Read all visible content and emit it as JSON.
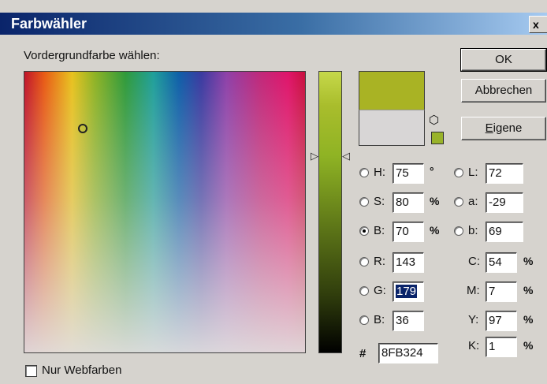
{
  "window": {
    "title": "Farbwähler",
    "close_glyph": "x"
  },
  "prompt": "Vordergrundfarbe wählen:",
  "buttons": {
    "ok": "OK",
    "cancel": "Abbrechen",
    "custom_first": "E",
    "custom_rest": "igene"
  },
  "colors": {
    "new": "#A9B324",
    "old": "#D8D6D6",
    "web_safe": "#99B32A"
  },
  "hsb": [
    {
      "label": "H:",
      "value": "75",
      "unit": "°",
      "checked": false
    },
    {
      "label": "S:",
      "value": "80",
      "unit": "%",
      "checked": false
    },
    {
      "label": "B:",
      "value": "70",
      "unit": "%",
      "checked": true
    }
  ],
  "lab": [
    {
      "label": "L:",
      "value": "72"
    },
    {
      "label": "a:",
      "value": "-29"
    },
    {
      "label": "b:",
      "value": "69"
    }
  ],
  "rgb": [
    {
      "label": "R:",
      "value": "143"
    },
    {
      "label": "G:",
      "value": "179",
      "selected": true
    },
    {
      "label": "B:",
      "value": "36"
    }
  ],
  "cmyk": [
    {
      "label": "C:",
      "value": "54",
      "unit": "%"
    },
    {
      "label": "M:",
      "value": "7",
      "unit": "%"
    },
    {
      "label": "Y:",
      "value": "97",
      "unit": "%"
    },
    {
      "label": "K:",
      "value": "1",
      "unit": "%"
    }
  ],
  "hex": {
    "label": "#",
    "value": "8FB324"
  },
  "web_only": {
    "label": "Nur Webfarben",
    "checked": false
  }
}
